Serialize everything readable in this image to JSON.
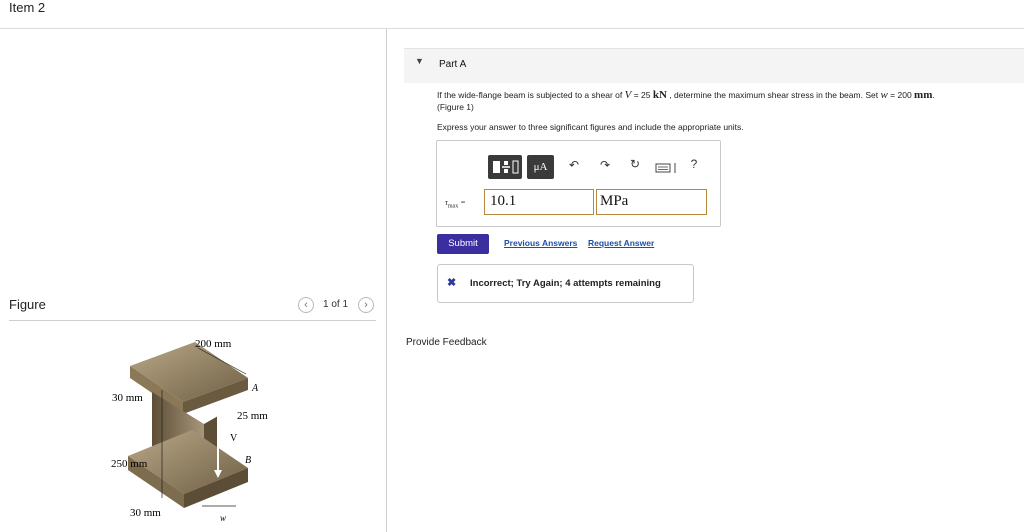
{
  "header": {
    "item_title": "Item 2"
  },
  "figure_panel": {
    "label": "Figure",
    "pagination": "1 of 1",
    "prev_glyph": "‹",
    "next_glyph": "›",
    "labels": {
      "top_width": "200 mm",
      "flange_thickness": "30 mm",
      "web_thickness": "25 mm",
      "web_height": "250 mm",
      "bottom_flange": "30 mm",
      "point_a": "A",
      "point_b": "B",
      "shear": "V",
      "w": "w"
    }
  },
  "part_a": {
    "caret": "▼",
    "title": "Part A",
    "problem_pre": "If the wide-flange beam is subjected to a shear of ",
    "problem_var": "V",
    "problem_eq": " = 25 ",
    "problem_unit": "kN",
    "problem_mid": " , determine the maximum shear stress in the beam. Set ",
    "problem_w": "w",
    "problem_w_eq": " = 200 ",
    "problem_w_unit": "mm",
    "problem_end": ".",
    "figure_ref": "(Figure 1)",
    "instruction": "Express your answer to three significant figures and include the appropriate units.",
    "toolbar": {
      "mu_label": "μA",
      "undo": "↶",
      "redo": "↷",
      "reset": "↻",
      "help": "?"
    },
    "answer_label": "τ",
    "answer_sub": "max",
    "answer_eq": " =",
    "answer_value": "10.1",
    "answer_unit": "MPa",
    "submit_label": "Submit",
    "previous_answers_label": "Previous Answers",
    "request_answer_label": "Request Answer",
    "feedback_icon": "✖",
    "feedback_text": "Incorrect; Try Again; 4 attempts remaining"
  },
  "footer": {
    "provide_feedback": "Provide Feedback"
  },
  "colors": {
    "submit_bg": "#3b2fa0",
    "link": "#1f4ea8",
    "input_border": "#b58a3d",
    "beam": "#8c7a5c"
  }
}
